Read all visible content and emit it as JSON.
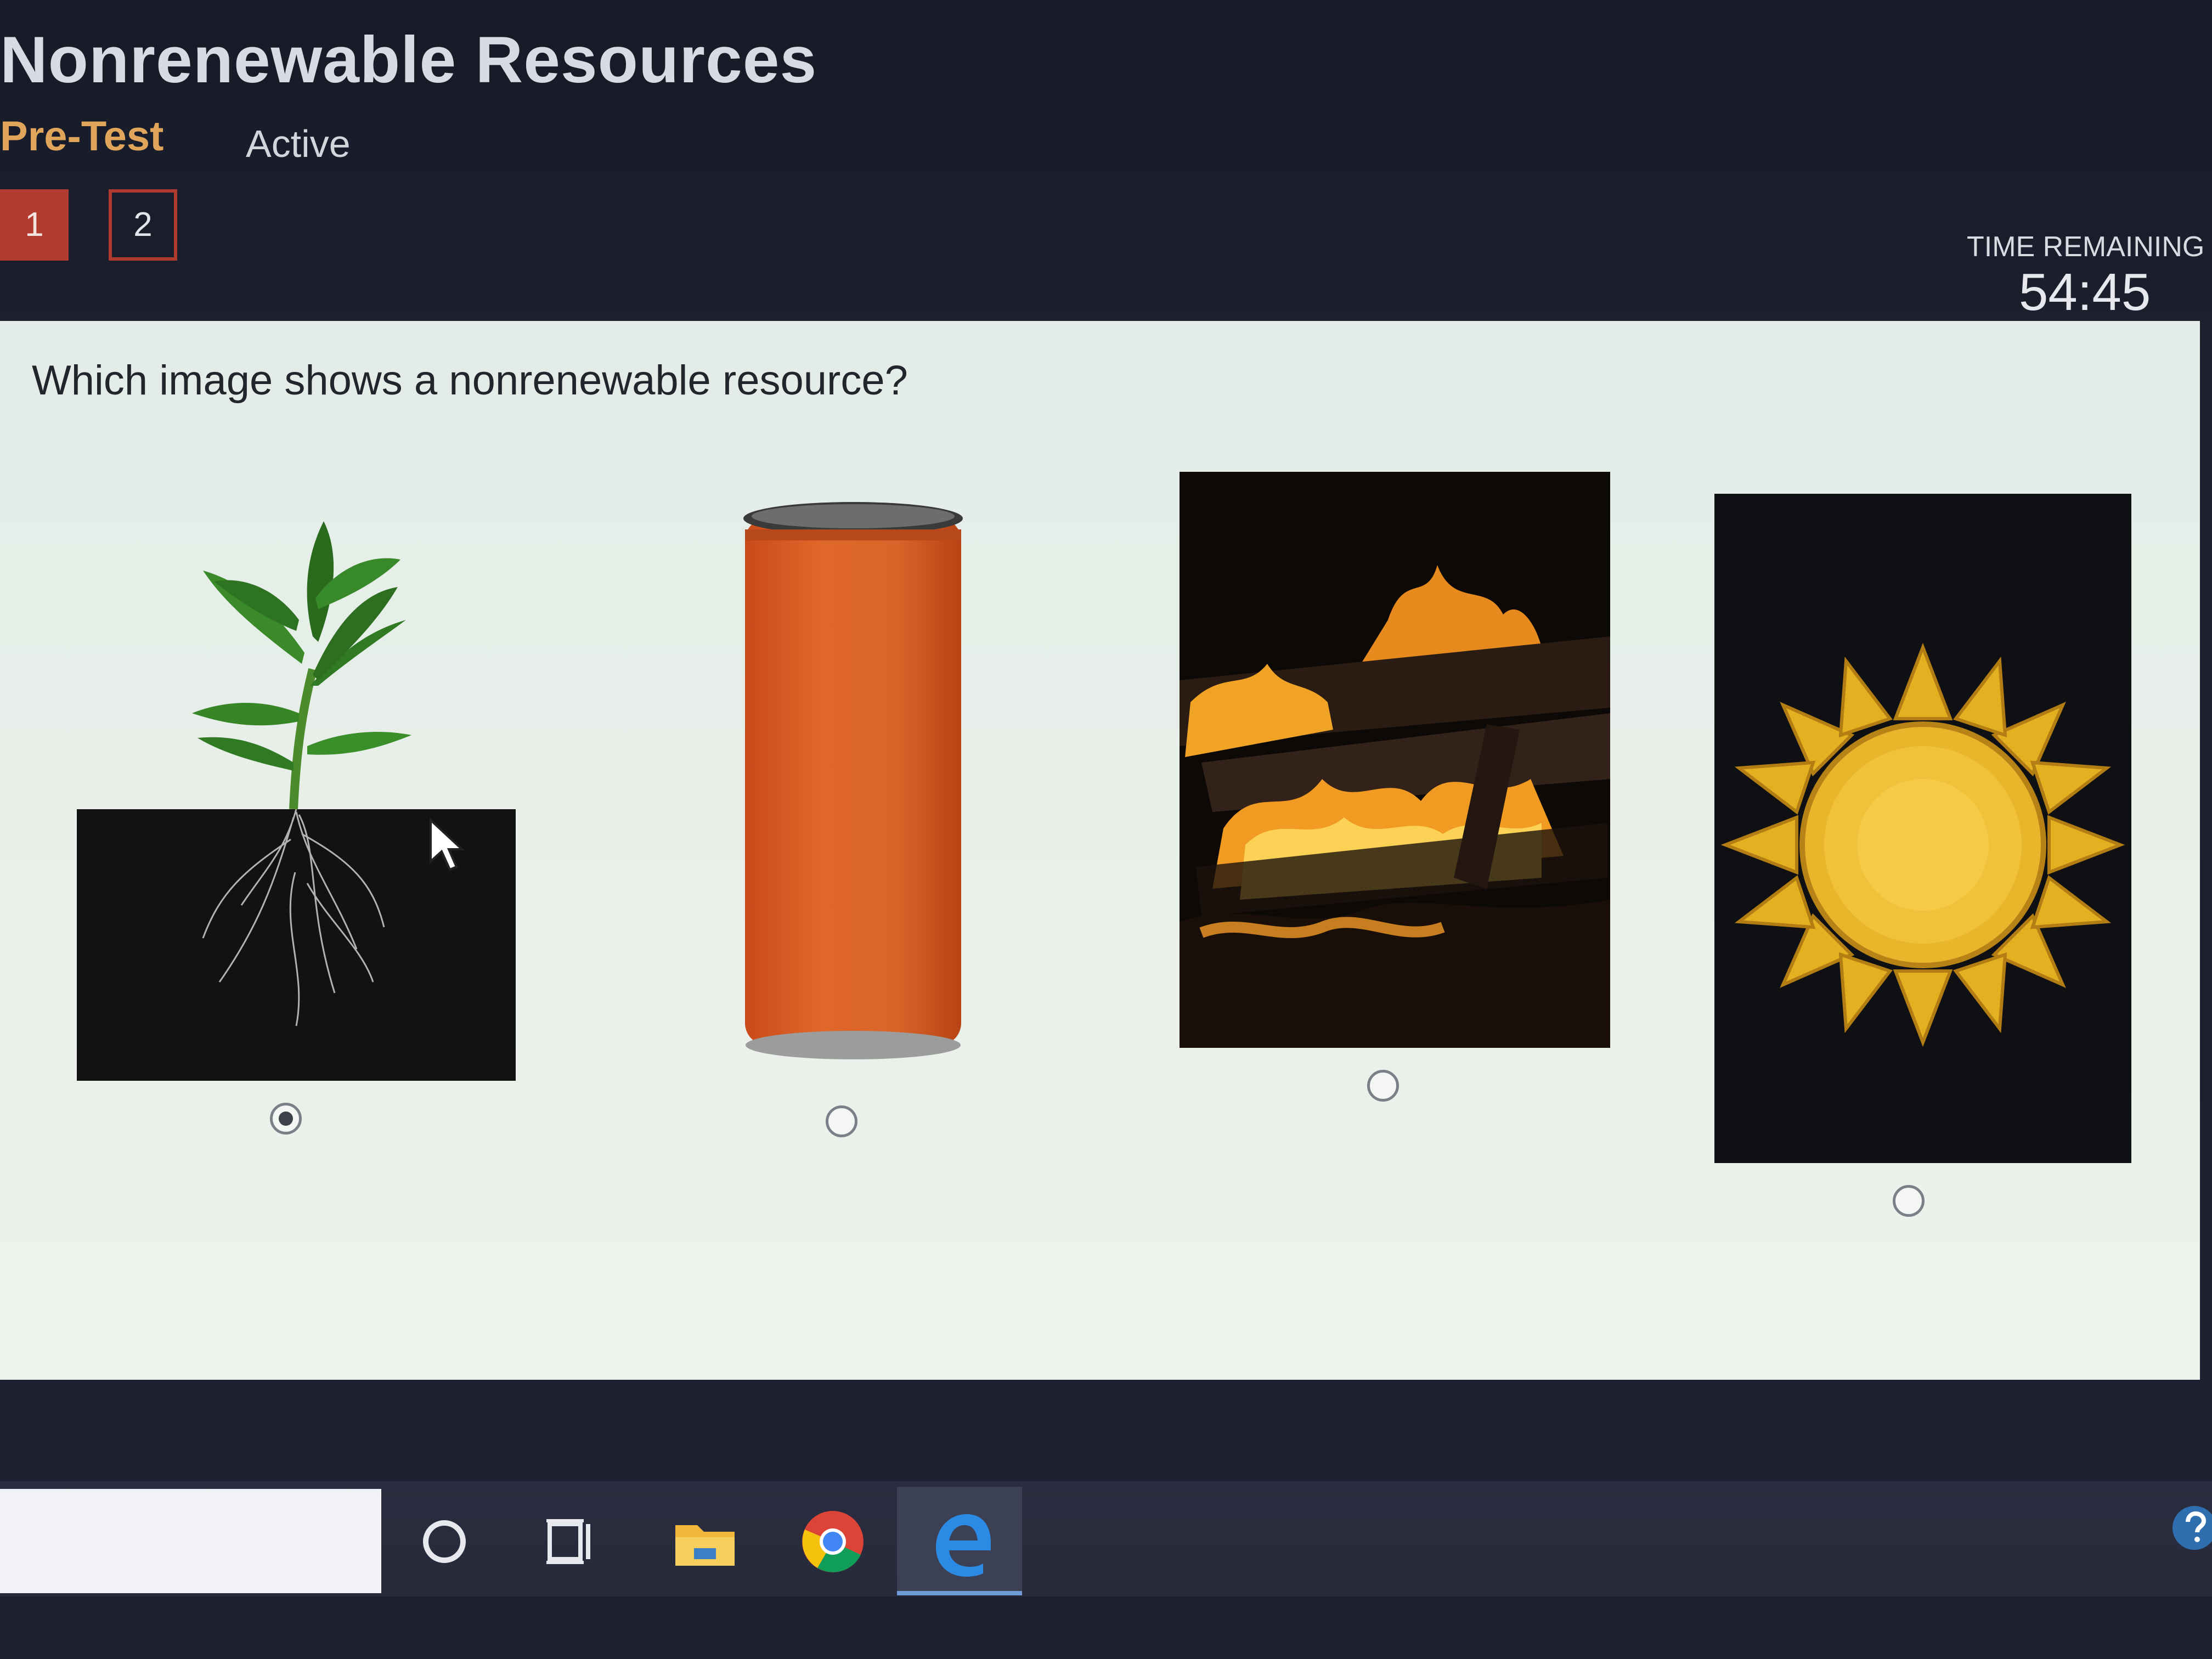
{
  "header": {
    "lesson_title": "Nonrenewable Resources",
    "tabs": [
      {
        "label": "Pre-Test",
        "active": true,
        "color": "#e0a45a"
      },
      {
        "label": "Active",
        "active": false
      }
    ],
    "question_numbers": [
      {
        "label": "1",
        "current": true
      },
      {
        "label": "2",
        "current": false
      }
    ],
    "timer": {
      "label": "TIME REMAINING",
      "value": "54:45"
    }
  },
  "question": {
    "prompt": "Which image shows a nonrenewable resource?",
    "choices": [
      {
        "image": "plant-with-roots",
        "selected": true
      },
      {
        "image": "orange-can",
        "selected": false
      },
      {
        "image": "campfire",
        "selected": false
      },
      {
        "image": "sun",
        "selected": false
      }
    ]
  },
  "taskbar": {
    "icons": [
      "search-circle-icon",
      "task-view-icon",
      "file-explorer-icon",
      "chrome-icon",
      "edge-icon"
    ],
    "help_icon": "help-icon"
  },
  "colors": {
    "accent_red": "#b33a2e",
    "tab_orange": "#e0a45a",
    "panel_bg": "#e8efe9"
  }
}
